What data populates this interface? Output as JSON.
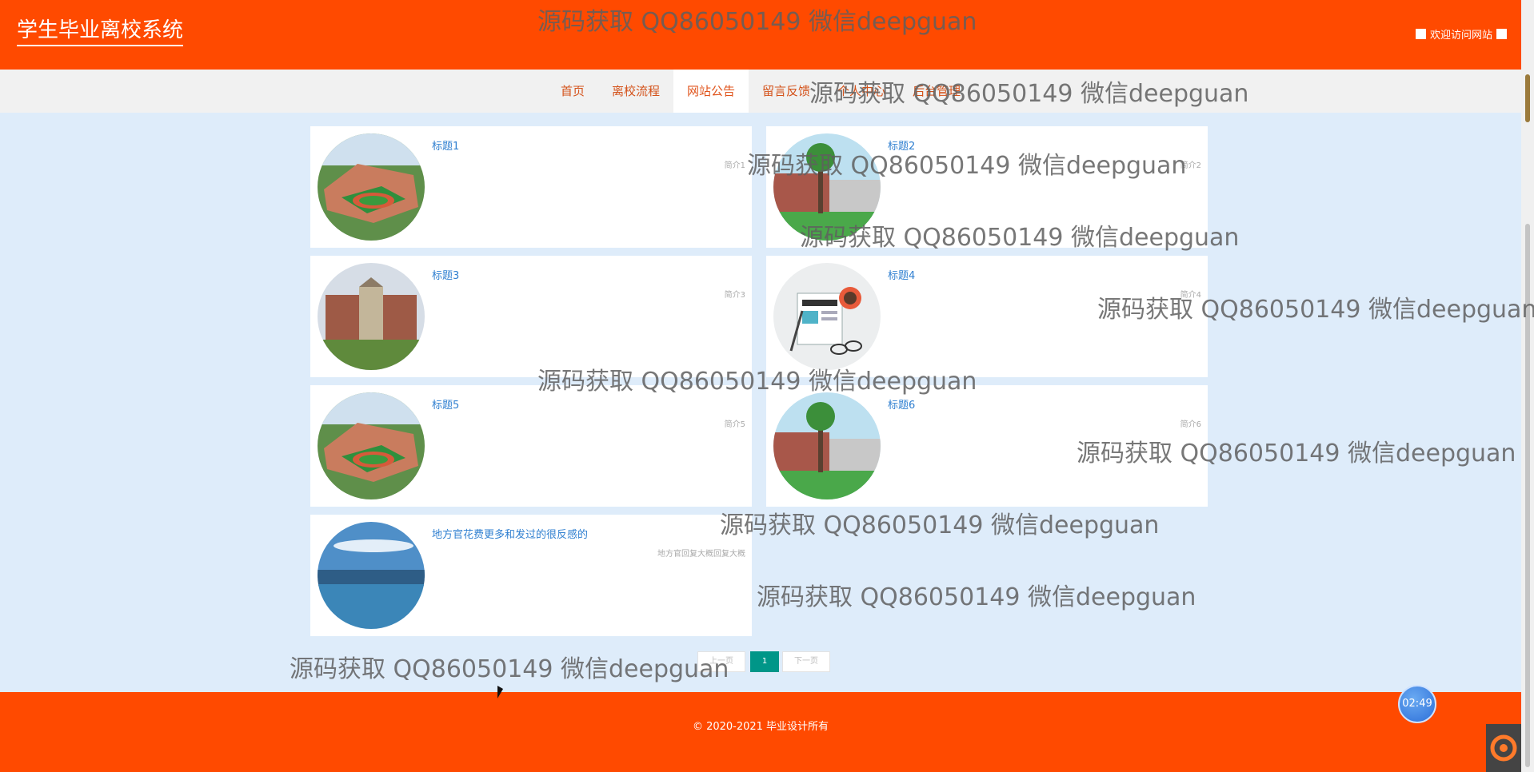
{
  "header": {
    "title": "学生毕业离校系统",
    "welcome": "欢迎访问网站"
  },
  "nav": [
    "首页",
    "离校流程",
    "网站公告",
    "留言反馈",
    "个人中心",
    "后台管理"
  ],
  "cards": [
    {
      "title": "标题1",
      "intro": "简介1"
    },
    {
      "title": "标题2",
      "intro": "简介2"
    },
    {
      "title": "标题3",
      "intro": "简介3"
    },
    {
      "title": "标题4",
      "intro": "简介4"
    },
    {
      "title": "标题5",
      "intro": "简介5"
    },
    {
      "title": "标题6",
      "intro": "简介6"
    },
    {
      "title": "地方官花费更多和发过的很反感的",
      "intro": "地方官回复大概回复大概"
    }
  ],
  "pagination": {
    "prev": "上一页",
    "current": "1",
    "next": "下一页"
  },
  "footer": {
    "copyright": "© 2020-2021 毕业设计所有"
  },
  "timer": "02:49",
  "watermark": "源码获取 QQ86050149 微信deepguan"
}
